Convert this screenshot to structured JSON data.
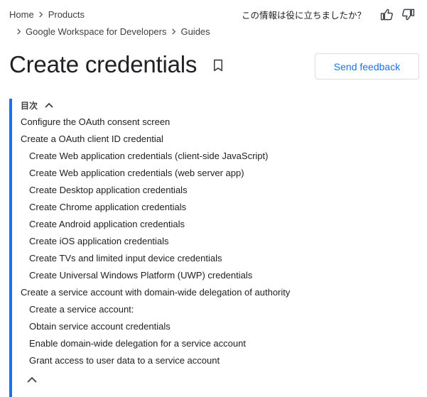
{
  "breadcrumb": {
    "row1": [
      "Home",
      "Products"
    ],
    "row2": [
      "Google Workspace for Developers",
      "Guides"
    ]
  },
  "helpful": {
    "question": "この情報は役に立ちましたか？",
    "thumbs_up_icon": "thumb-up-icon",
    "thumbs_down_icon": "thumb-down-icon"
  },
  "page": {
    "title": "Create credentials",
    "bookmark_icon": "bookmark-icon"
  },
  "feedback": {
    "label": "Send feedback"
  },
  "toc": {
    "header": "目次",
    "items": [
      {
        "label": "Configure the OAuth consent screen",
        "level": 1
      },
      {
        "label": "Create a OAuth client ID credential",
        "level": 1
      },
      {
        "label": "Create Web application credentials (client-side JavaScript)",
        "level": 2
      },
      {
        "label": "Create Web application credentials (web server app)",
        "level": 2
      },
      {
        "label": "Create Desktop application credentials",
        "level": 2
      },
      {
        "label": "Create Chrome application credentials",
        "level": 2
      },
      {
        "label": "Create Android application credentials",
        "level": 2
      },
      {
        "label": "Create iOS application credentials",
        "level": 2
      },
      {
        "label": "Create TVs and limited input device credentials",
        "level": 2
      },
      {
        "label": "Create Universal Windows Platform (UWP) credentials",
        "level": 2
      },
      {
        "label": "Create a service account with domain-wide delegation of authority",
        "level": 1
      },
      {
        "label": "Create a service account:",
        "level": 2
      },
      {
        "label": "Obtain service account credentials",
        "level": 2
      },
      {
        "label": "Enable domain-wide delegation for a service account",
        "level": 2
      },
      {
        "label": "Grant access to user data to a service account",
        "level": 2
      }
    ]
  },
  "colors": {
    "accent": "#1a73e8",
    "text": "#202124",
    "border": "#dadce0"
  }
}
